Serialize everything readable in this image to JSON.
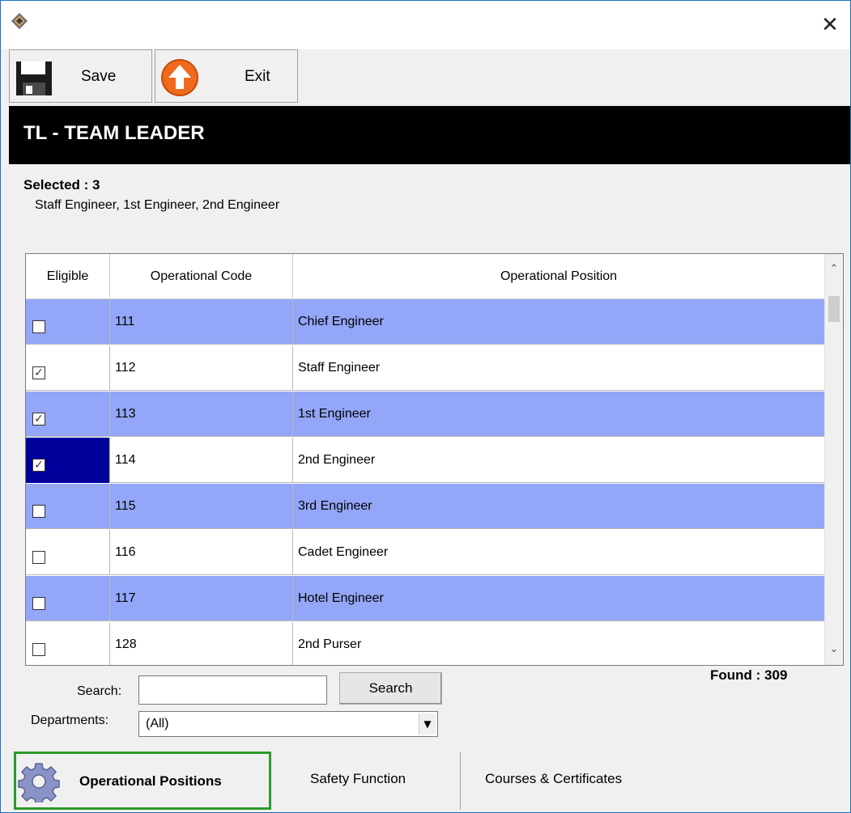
{
  "window": {
    "close_glyph": "✕"
  },
  "toolbar": {
    "save_label": "Save",
    "exit_label": "Exit"
  },
  "header": {
    "title": "TL - TEAM LEADER"
  },
  "selection": {
    "count_text": "Selected : 3",
    "list_text": "Staff Engineer, 1st Engineer, 2nd Engineer"
  },
  "grid": {
    "headers": [
      "Eligible",
      "Operational Code",
      "Operational Position"
    ],
    "rows": [
      {
        "checked": false,
        "code": "111",
        "position": "Chief Engineer",
        "highlight": true
      },
      {
        "checked": true,
        "code": "112",
        "position": "Staff Engineer",
        "highlight": false
      },
      {
        "checked": true,
        "code": "113",
        "position": "1st Engineer",
        "highlight": true
      },
      {
        "checked": true,
        "code": "114",
        "position": "2nd Engineer",
        "highlight": false,
        "focused": true
      },
      {
        "checked": false,
        "code": "115",
        "position": "3rd Engineer",
        "highlight": true
      },
      {
        "checked": false,
        "code": "116",
        "position": "Cadet Engineer",
        "highlight": false
      },
      {
        "checked": false,
        "code": "117",
        "position": "Hotel Engineer",
        "highlight": true
      },
      {
        "checked": false,
        "code": "128",
        "position": "2nd Purser",
        "highlight": false
      }
    ],
    "found_text": "Found : 309"
  },
  "search": {
    "label": "Search:",
    "value": "",
    "button_label": "Search"
  },
  "departments": {
    "label": "Departments:",
    "selected": "(All)"
  },
  "tabs": [
    {
      "label": "Operational Positions",
      "active": true,
      "icon": "gear-icon"
    },
    {
      "label": "Safety Function",
      "active": false
    },
    {
      "label": "Courses & Certificates",
      "active": false
    }
  ],
  "colors": {
    "row_highlight": "#93a6f7",
    "focus_cell": "#00009a",
    "active_tab_border": "#2c9a2c"
  }
}
